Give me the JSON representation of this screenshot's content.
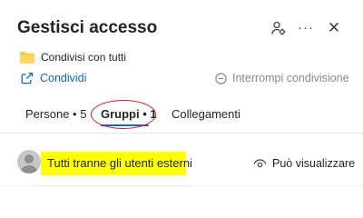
{
  "header": {
    "title": "Gestisci accesso",
    "icons": [
      "people-settings-icon",
      "more-icon",
      "close-icon"
    ],
    "more_label": "···",
    "close_label": "✕"
  },
  "item": {
    "icon": "folder-icon",
    "name": "Condivisi con tutti",
    "folder_color": "#ffc83d"
  },
  "actions": {
    "share_label": "Condividi",
    "share_icon": "share-icon",
    "stop_label": "Interrompi condivisione",
    "stop_icon": "stop-circle-icon"
  },
  "tabs": [
    {
      "label": "Persone • 5",
      "selected": false
    },
    {
      "label": "Gruppi • 1",
      "selected": true
    },
    {
      "label": "Collegamenti",
      "selected": false
    }
  ],
  "group_entry": {
    "name": "Tutti tranne gli utenti esterni",
    "avatar_icon": "person-avatar-icon",
    "permission_label": "Può visualizzare",
    "permission_icon": "eye-icon"
  },
  "colors": {
    "accent": "#0f6cbd",
    "annotation_highlight": "#ffff00",
    "annotation_circle": "#d41c23"
  }
}
